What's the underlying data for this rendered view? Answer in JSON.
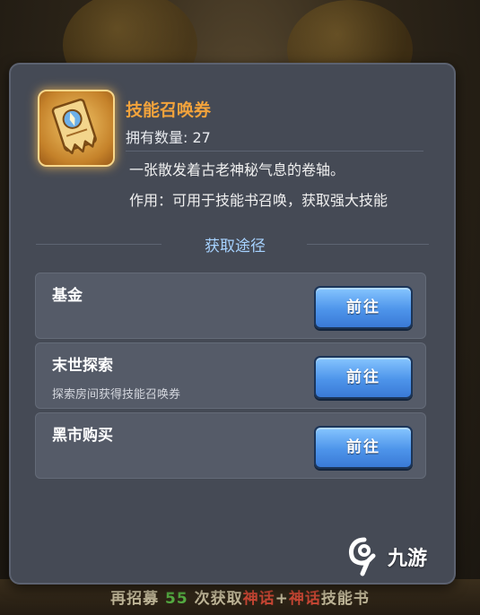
{
  "item": {
    "name": "技能召唤券",
    "owned_label": "拥有数量:",
    "owned_count": "27",
    "description": "一张散发着古老神秘气息的卷轴。",
    "usage": "作用：可用于技能书召唤，获取强大技能",
    "icon": "scroll-ticket-icon"
  },
  "section_title": "获取途径",
  "sources": [
    {
      "title": "基金",
      "subtitle": "",
      "button": "前往"
    },
    {
      "title": "末世探索",
      "subtitle": "探索房间获得技能召唤券",
      "button": "前往"
    },
    {
      "title": "黑市购买",
      "subtitle": "",
      "button": "前往"
    }
  ],
  "background": {
    "bottom_text_prefix": "再招募",
    "bottom_text_num": "55",
    "bottom_text_mid": "次获取",
    "bottom_text_red1": "神话",
    "bottom_text_sep": "+",
    "bottom_text_red2": "神话",
    "bottom_text_suffix": "技能书"
  },
  "watermark": {
    "text": "九游",
    "icon": "jiuyou-logo-icon"
  },
  "colors": {
    "item_name": "#f2a33c",
    "section_title": "#a6d2ff",
    "button": "#4d94ea",
    "panel": "#454a55"
  }
}
